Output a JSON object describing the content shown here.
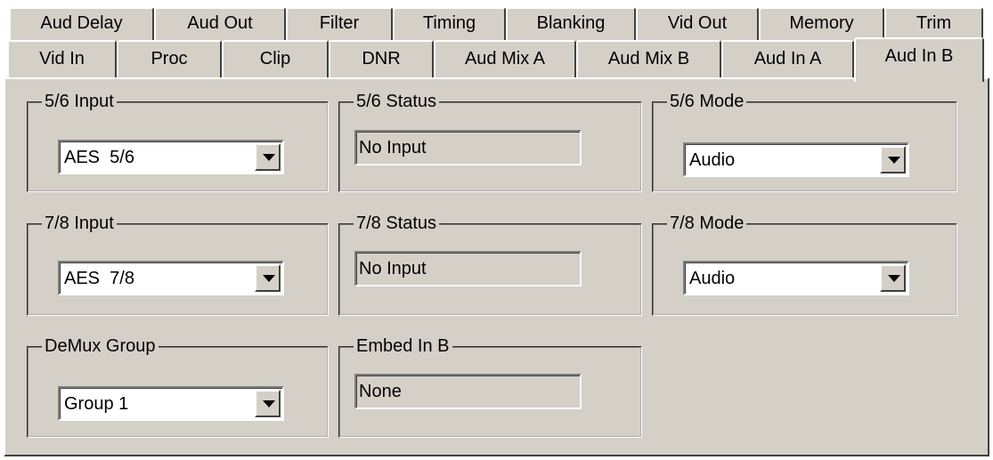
{
  "tabs_row1": [
    {
      "label": "Aud Delay"
    },
    {
      "label": "Aud Out"
    },
    {
      "label": "Filter"
    },
    {
      "label": "Timing"
    },
    {
      "label": "Blanking"
    },
    {
      "label": "Vid Out"
    },
    {
      "label": "Memory"
    },
    {
      "label": "Trim"
    }
  ],
  "tabs_row2": [
    {
      "label": "Vid In"
    },
    {
      "label": "Proc"
    },
    {
      "label": "Clip"
    },
    {
      "label": "DNR"
    },
    {
      "label": "Aud Mix A"
    },
    {
      "label": "Aud Mix B"
    },
    {
      "label": "Aud In A"
    },
    {
      "label": "Aud In B",
      "active": true
    }
  ],
  "groups": {
    "input_56": {
      "title": "5/6 Input",
      "value": "AES  5/6"
    },
    "status_56": {
      "title": "5/6 Status",
      "value": "No Input"
    },
    "mode_56": {
      "title": "5/6 Mode",
      "value": "Audio"
    },
    "input_78": {
      "title": "7/8 Input",
      "value": "AES  7/8"
    },
    "status_78": {
      "title": "7/8 Status",
      "value": "No Input"
    },
    "mode_78": {
      "title": "7/8 Mode",
      "value": "Audio"
    },
    "demux_group": {
      "title": "DeMux Group",
      "value": "Group 1"
    },
    "embed_in_b": {
      "title": "Embed In B",
      "value": "None"
    }
  }
}
